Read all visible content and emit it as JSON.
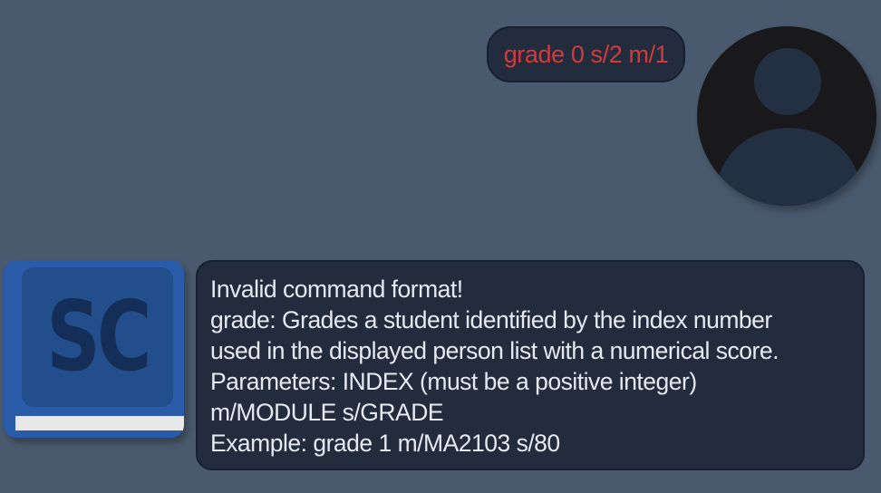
{
  "user_message": {
    "text": "grade 0 s/2 m/1",
    "color": "#d23a3a"
  },
  "user_avatar": {
    "icon": "user-silhouette-icon"
  },
  "bot_avatar": {
    "icon": "book-icon",
    "logo_text": "SC"
  },
  "bot_message": {
    "lines": [
      "Invalid command format!",
      "grade: Grades a student identified by the index number",
      "used in the displayed person list with a numerical score.",
      "Parameters: INDEX (must be a positive integer)",
      "m/MODULE s/GRADE",
      "Example: grade 1 m/MA2103 s/80"
    ]
  },
  "colors": {
    "background": "#4a5a6e",
    "bubble": "#232c3d",
    "error_text": "#d23a3a",
    "bot_text": "#e6e9ef",
    "book_blue": "#2a5ba8"
  }
}
